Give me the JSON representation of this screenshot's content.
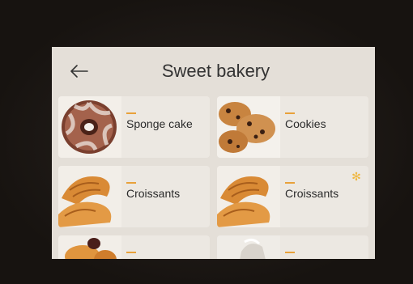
{
  "header": {
    "back_icon": "arrow-left-icon",
    "title": "Sweet bakery"
  },
  "items": [
    {
      "label": "Sponge cake",
      "image": "bundt-cake-image",
      "flag": ""
    },
    {
      "label": "Cookies",
      "image": "cookies-image",
      "flag": ""
    },
    {
      "label": "Croissants",
      "image": "croissants-image",
      "flag": ""
    },
    {
      "label": "Croissants",
      "image": "croissants-image",
      "flag": "snowflake-icon"
    },
    {
      "label": "",
      "image": "pastry-image",
      "flag": ""
    },
    {
      "label": "",
      "image": "cream-cup-image",
      "flag": ""
    }
  ],
  "colors": {
    "accent": "#e8a13a",
    "screen_bg": "#e4dfd8",
    "card_bg": "#ece8e2",
    "text": "#333333"
  }
}
